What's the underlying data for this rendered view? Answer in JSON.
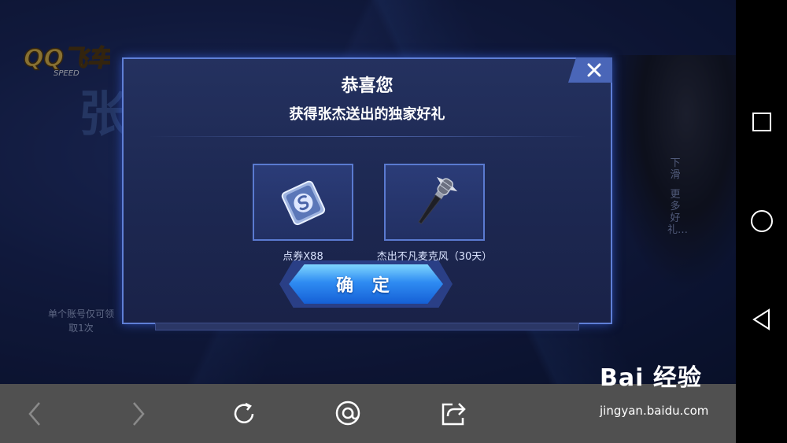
{
  "background": {
    "logo_text": "QQ飞车",
    "logo_sub": "SPEED",
    "bg_title": "张杰",
    "left_note": "单个账号仅可领取1次",
    "side_hint_top": "下滑",
    "side_hint_bottom": "更多好礼…"
  },
  "modal": {
    "title": "恭喜您",
    "subtitle": "获得张杰送出的独家好礼",
    "items": [
      {
        "label": "点券X88",
        "icon": "coupon-card-icon"
      },
      {
        "label": "杰出不凡麦克风（30天）",
        "icon": "microphone-icon"
      }
    ],
    "confirm_label": "确 定",
    "close_icon": "close-icon"
  },
  "toolbar": {
    "buttons": [
      "back-arrow-icon",
      "forward-arrow-icon",
      "refresh-icon",
      "comment-icon",
      "share-icon"
    ]
  },
  "watermark": {
    "brand": "Bai 经验",
    "url": "jingyan.baidu.com"
  },
  "navbar": {
    "buttons": [
      "recent-apps-icon",
      "home-icon",
      "back-icon"
    ]
  },
  "colors": {
    "accent": "#2f8cf2",
    "modal_border": "#5f7fd6",
    "toolbar": "#505050"
  }
}
